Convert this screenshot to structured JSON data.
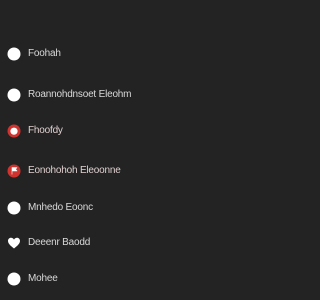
{
  "menu": {
    "items": [
      {
        "label": "Foohah",
        "icon": "circle-icon"
      },
      {
        "label": "Roannohdnsoet Eleohm",
        "icon": "circle-icon"
      },
      {
        "label": "Fhoofdy",
        "icon": "record-icon"
      },
      {
        "label": "Eonohohoh Eleoonne",
        "icon": "flag-icon"
      },
      {
        "label": "Mnhedo Eoonc",
        "icon": "circle-icon"
      },
      {
        "label": "Deeenr Baodd",
        "icon": "heart-icon"
      },
      {
        "label": "Mohee",
        "icon": "circle-icon"
      }
    ]
  },
  "colors": {
    "background": "#232323",
    "accent_red": "#d0332f",
    "icon_white": "#ffffff",
    "text": "#d9d9d9"
  }
}
